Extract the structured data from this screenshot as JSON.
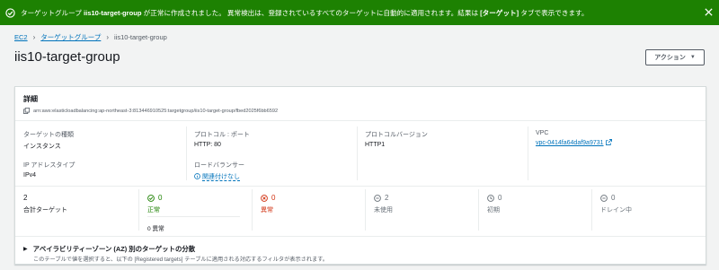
{
  "banner": {
    "pre": "ターゲットグループ ",
    "name": "iis10-target-group",
    "mid": " が正常に作成されました。 異常検出は、登録されているすべてのターゲットに自動的に適用されます。結果は ",
    "tab": "[ターゲット]",
    "post": " タブで表示できます。",
    "color": "#1d8102"
  },
  "breadcrumb": {
    "items": [
      "EC2",
      "ターゲットグループ",
      "iis10-target-group"
    ]
  },
  "page": {
    "title": "iis10-target-group",
    "action_label": "アクション"
  },
  "details": {
    "heading": "詳細",
    "arn": "arn:aws:elasticloadbalancing:ap-northeast-3:813446910525:targetgroup/iis10-target-group/fbed2025f6bb6592",
    "target_type": {
      "label": "ターゲットの種類",
      "value": "インスタンス"
    },
    "protocol_port": {
      "label": "プロトコル : ポート",
      "value": "HTTP: 80"
    },
    "protocol_version": {
      "label": "プロトコルバージョン",
      "value": "HTTP1"
    },
    "vpc": {
      "label": "VPC",
      "value": "vpc-0414fa64daf9a9731"
    },
    "ip_type": {
      "label": "IP アドレスタイプ",
      "value": "IPv4"
    },
    "load_balancer": {
      "label": "ロードバランサー",
      "value": "関連付けなし"
    }
  },
  "stats": {
    "total": {
      "count": "2",
      "label": "合計ターゲット"
    },
    "healthy": {
      "count": "0",
      "label": "正常",
      "sub": "0 異常",
      "color": "#1d8102"
    },
    "unhealthy": {
      "count": "0",
      "label": "異常",
      "color": "#d13212"
    },
    "unused": {
      "count": "2",
      "label": "未使用"
    },
    "initial": {
      "count": "0",
      "label": "初期"
    },
    "draining": {
      "count": "0",
      "label": "ドレイン中"
    }
  },
  "az": {
    "title": "アベイラビリティーゾーン (AZ) 別のターゲットの分散",
    "desc": "このテーブルで値を選択すると、以下の [Registered targets] テーブルに適用される対応するフィルタが表示されます。"
  }
}
